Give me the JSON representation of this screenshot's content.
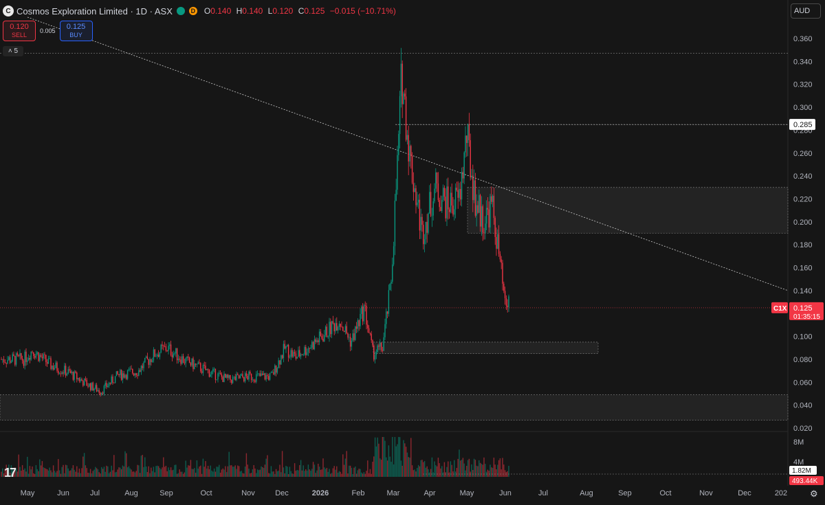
{
  "header": {
    "title": "Cosmos Exploration Limited · 1D · ASX",
    "logo_glyph": "C",
    "ohlc": [
      {
        "k": "O",
        "v": "0.140"
      },
      {
        "k": "H",
        "v": "0.140"
      },
      {
        "k": "L",
        "v": "0.120"
      },
      {
        "k": "C",
        "v": "0.125"
      }
    ],
    "change": "−0.015 (−10.71%)",
    "indicator_label": "D"
  },
  "trade": {
    "sell_price": "0.120",
    "sell_label": "SELL",
    "spread": "0.005",
    "buy_price": "0.125",
    "buy_label": "BUY"
  },
  "collapse_label": "5",
  "currency": "AUD",
  "colors": {
    "up": "#089981",
    "down": "#f23645",
    "background": "#161616",
    "grid_text": "#b2b5be",
    "price_line": "#f23645"
  },
  "icons": {
    "logo": "tradingview-logo-icon",
    "settings": "gear-icon",
    "chevron": "chevron-up-icon"
  },
  "chart_data": {
    "type": "candlestick",
    "symbol": "C1X",
    "y_ticks": [
      "0.360",
      "0.340",
      "0.320",
      "0.300",
      "0.280",
      "0.260",
      "0.240",
      "0.220",
      "0.200",
      "0.180",
      "0.160",
      "0.140",
      "0.120",
      "0.100",
      "0.080",
      "0.060",
      "0.040",
      "0.020"
    ],
    "ylim": [
      0.02,
      0.36
    ],
    "x_ticks": [
      "May",
      "Jun",
      "Jul",
      "Aug",
      "Sep",
      "Oct",
      "Nov",
      "Dec",
      "2026",
      "Feb",
      "Mar",
      "Apr",
      "May",
      "Jun",
      "Jul",
      "Aug",
      "Sep",
      "Oct",
      "Nov",
      "Dec",
      "202"
    ],
    "price_path": [
      {
        "date": "2025-04-28",
        "close": 0.08
      },
      {
        "date": "2025-05-05",
        "close": 0.088
      },
      {
        "date": "2025-05-20",
        "close": 0.075
      },
      {
        "date": "2025-06-05",
        "close": 0.068
      },
      {
        "date": "2025-06-20",
        "close": 0.058
      },
      {
        "date": "2025-07-01",
        "close": 0.052
      },
      {
        "date": "2025-07-15",
        "close": 0.066
      },
      {
        "date": "2025-08-01",
        "close": 0.07
      },
      {
        "date": "2025-08-15",
        "close": 0.085
      },
      {
        "date": "2025-08-25",
        "close": 0.09
      },
      {
        "date": "2025-09-10",
        "close": 0.078
      },
      {
        "date": "2025-10-01",
        "close": 0.068
      },
      {
        "date": "2025-10-15",
        "close": 0.062
      },
      {
        "date": "2025-11-01",
        "close": 0.065
      },
      {
        "date": "2025-11-20",
        "close": 0.065
      },
      {
        "date": "2025-12-01",
        "close": 0.09
      },
      {
        "date": "2025-12-10",
        "close": 0.082
      },
      {
        "date": "2025-12-20",
        "close": 0.09
      },
      {
        "date": "2026-01-01",
        "close": 0.1
      },
      {
        "date": "2026-01-15",
        "close": 0.115
      },
      {
        "date": "2026-01-25",
        "close": 0.095
      },
      {
        "date": "2026-02-05",
        "close": 0.125
      },
      {
        "date": "2026-02-12",
        "close": 0.085
      },
      {
        "date": "2026-02-20",
        "close": 0.09
      },
      {
        "date": "2026-02-27",
        "close": 0.145
      },
      {
        "date": "2026-03-05",
        "close": 0.26
      },
      {
        "date": "2026-03-08",
        "close": 0.33
      },
      {
        "date": "2026-03-15",
        "close": 0.255
      },
      {
        "date": "2026-03-25",
        "close": 0.19
      },
      {
        "date": "2026-04-05",
        "close": 0.23
      },
      {
        "date": "2026-04-15",
        "close": 0.215
      },
      {
        "date": "2026-04-25",
        "close": 0.22
      },
      {
        "date": "2026-05-01",
        "close": 0.275
      },
      {
        "date": "2026-05-08",
        "close": 0.22
      },
      {
        "date": "2026-05-15",
        "close": 0.2
      },
      {
        "date": "2026-05-22",
        "close": 0.215
      },
      {
        "date": "2026-05-28",
        "close": 0.17
      },
      {
        "date": "2026-06-02",
        "close": 0.125
      },
      {
        "date": "2026-06-05",
        "close": 0.13
      }
    ],
    "last_price_label": "0.125",
    "countdown": "01:35:15",
    "high_marker_label": "0.285",
    "zones": [
      {
        "y1": 0.285,
        "y2": 0.285
      },
      {
        "y1": 0.19,
        "y2": 0.23
      },
      {
        "y1": 0.085,
        "y2": 0.095
      },
      {
        "y1": 0.027,
        "y2": 0.049
      }
    ],
    "volume": {
      "y_ticks": [
        "8M",
        "4M"
      ],
      "last_label": "1.82M",
      "ma_label": "493.44K"
    }
  }
}
